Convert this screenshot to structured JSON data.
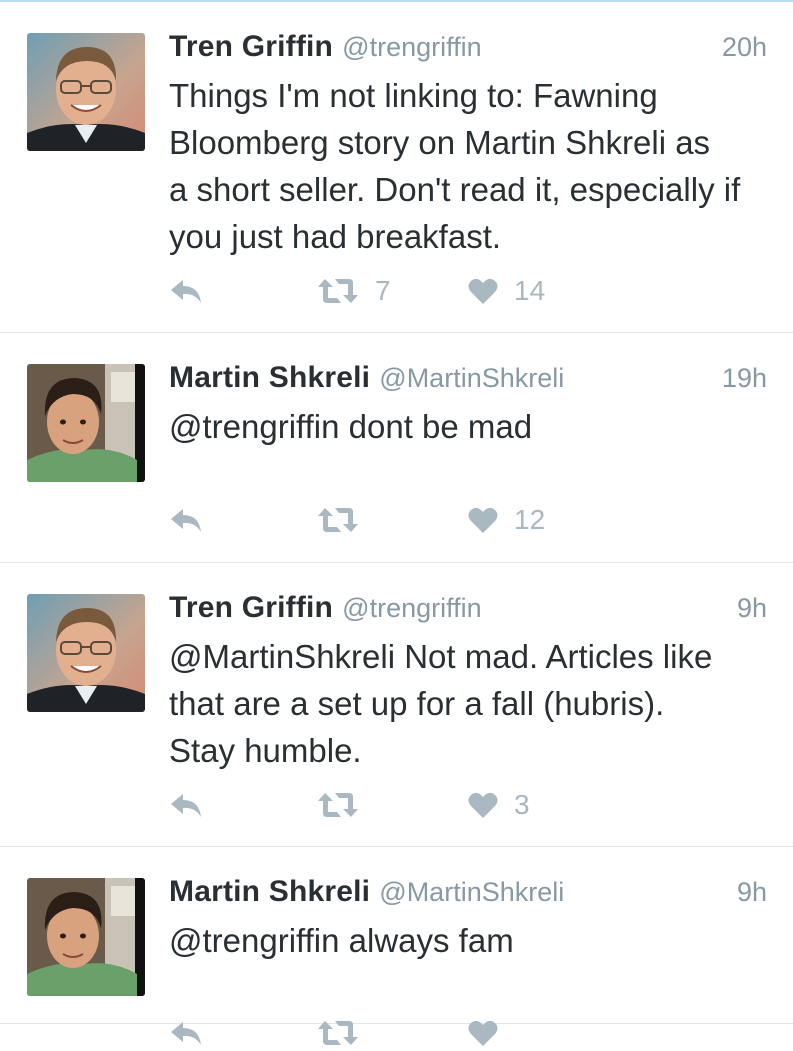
{
  "tweets": [
    {
      "name": "Tren Griffin",
      "handle": "@trengriffin",
      "time": "20h",
      "text": "Things I'm not linking to: Fawning\nBloomberg story on Martin Shkreli as\na short seller. Don't read it, especially if\nyou just had breakfast.",
      "retweets": "7",
      "likes": "14",
      "avatar": "tren-griffin-avatar"
    },
    {
      "name": "Martin Shkreli",
      "handle": "@MartinShkreli",
      "time": "19h",
      "text": "@trengriffin dont be mad",
      "retweets": "",
      "likes": "12",
      "avatar": "martin-shkreli-avatar"
    },
    {
      "name": "Tren Griffin",
      "handle": "@trengriffin",
      "time": "9h",
      "text": "@MartinShkreli Not mad. Articles like\nthat are a set up for a fall (hubris).\nStay humble.",
      "retweets": "",
      "likes": "3",
      "avatar": "tren-griffin-avatar"
    },
    {
      "name": "Martin Shkreli",
      "handle": "@MartinShkreli",
      "time": "9h",
      "text": "@trengriffin always fam",
      "retweets": "",
      "likes": "",
      "avatar": "martin-shkreli-avatar"
    }
  ],
  "icons": {
    "reply": "reply-icon",
    "retweet": "retweet-icon",
    "like": "heart-icon"
  },
  "colors": {
    "name": "#292f33",
    "meta": "#8899a6",
    "action": "#aab8c2",
    "divider": "#e1e8ed"
  }
}
